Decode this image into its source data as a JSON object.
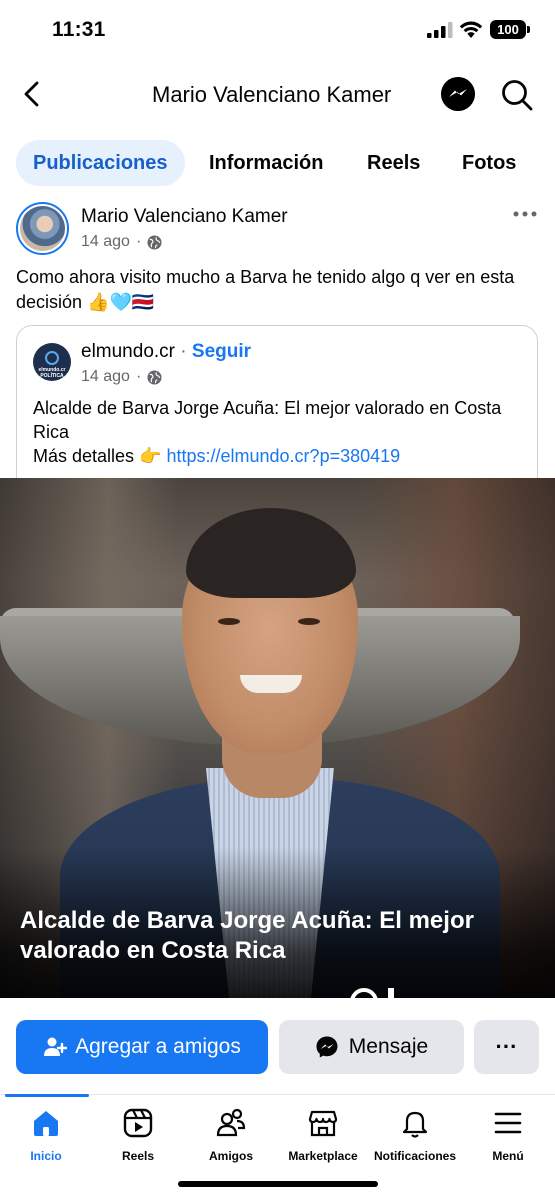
{
  "status_bar": {
    "time": "11:31",
    "battery": "100"
  },
  "header": {
    "title": "Mario Valenciano Kamer"
  },
  "tabs": [
    {
      "label": "Publicaciones",
      "active": true
    },
    {
      "label": "Información",
      "active": false
    },
    {
      "label": "Reels",
      "active": false
    },
    {
      "label": "Fotos",
      "active": false
    }
  ],
  "post": {
    "author": "Mario Valenciano Kamer",
    "time": "14 ago",
    "separator": "·",
    "text": "Como ahora visito mucho a Barva he tenido algo q ver en esta decisión 👍🩵🇨🇷",
    "shared": {
      "page_name": "elmundo.cr",
      "separator": "·",
      "follow": "Seguir",
      "time": "14 ago",
      "avatar_label": "elmundo.cr POLÍTICA",
      "line1": "Alcalde de Barva Jorge Acuña: El mejor valorado en Costa Rica",
      "line2_prefix": "Más detalles 👉",
      "link": "https://elmundo.cr?p=380419"
    },
    "image_caption": "Alcalde de Barva Jorge Acuña: El mejor valorado en Costa Rica"
  },
  "actions": {
    "add_friend": "Agregar a amigos",
    "message": "Mensaje",
    "more": "···"
  },
  "bottom_nav": [
    {
      "label": "Inicio",
      "icon": "home-icon",
      "active": true
    },
    {
      "label": "Reels",
      "icon": "reels-icon",
      "active": false
    },
    {
      "label": "Amigos",
      "icon": "friends-icon",
      "active": false
    },
    {
      "label": "Marketplace",
      "icon": "marketplace-icon",
      "active": false
    },
    {
      "label": "Notificaciones",
      "icon": "bell-icon",
      "active": false
    },
    {
      "label": "Menú",
      "icon": "menu-icon",
      "active": false
    }
  ],
  "colors": {
    "accent": "#1877f2",
    "tab_active_bg": "#e7f0fd",
    "secondary_text": "#65676b",
    "button_gray": "#e4e6eb"
  }
}
